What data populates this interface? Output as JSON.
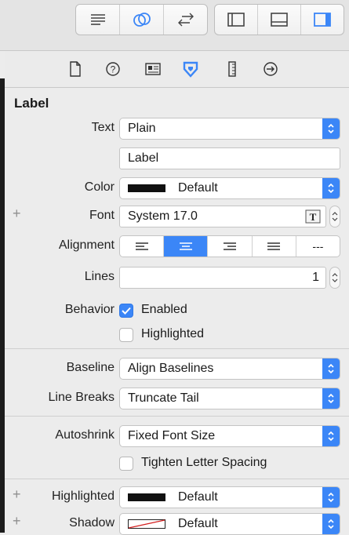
{
  "toolbar": {
    "editor_icons": [
      "standard-editor-icon",
      "assistant-editor-icon",
      "version-editor-icon"
    ],
    "view_icons": [
      "navigator-toggle-icon",
      "debug-area-toggle-icon",
      "utilities-toggle-icon"
    ]
  },
  "inspector_tabs": [
    "file-inspector-icon",
    "quick-help-icon",
    "identity-inspector-icon",
    "attributes-inspector-icon",
    "size-inspector-icon",
    "connections-inspector-icon"
  ],
  "section": {
    "title": "Label"
  },
  "text": {
    "label": "Text",
    "type": "Plain",
    "value": "Label"
  },
  "color": {
    "label": "Color",
    "value": "Default",
    "swatch": "#111111"
  },
  "font": {
    "label": "Font",
    "value": "System 17.0"
  },
  "alignment": {
    "label": "Alignment",
    "options": [
      "left",
      "center",
      "right",
      "justified",
      "natural"
    ],
    "natural_text": "---",
    "selected": "center"
  },
  "lines": {
    "label": "Lines",
    "value": "1"
  },
  "behavior": {
    "label": "Behavior",
    "enabled_label": "Enabled",
    "enabled": true,
    "highlighted_label": "Highlighted",
    "highlighted": false
  },
  "baseline": {
    "label": "Baseline",
    "value": "Align Baselines"
  },
  "line_breaks": {
    "label": "Line Breaks",
    "value": "Truncate Tail"
  },
  "autoshrink": {
    "label": "Autoshrink",
    "value": "Fixed Font Size",
    "tighten_label": "Tighten Letter Spacing",
    "tighten": false
  },
  "highlighted_color": {
    "label": "Highlighted",
    "value": "Default",
    "swatch": "#111111"
  },
  "shadow": {
    "label": "Shadow",
    "value": "Default"
  },
  "plus_symbol": "+",
  "accent_color": "#3b86f7"
}
